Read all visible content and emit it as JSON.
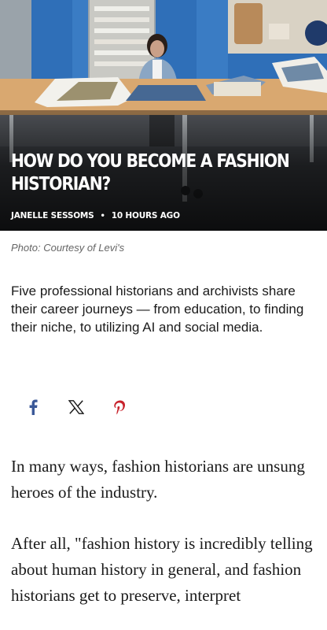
{
  "article": {
    "title": "HOW DO YOU BECOME A FASHION HISTORIAN?",
    "author": "JANELLE SESSOMS",
    "separator": "•",
    "time_ago": "10 HOURS AGO",
    "photo_caption": "Photo: Courtesy of Levi's",
    "dek": "Five professional historians and archivists share their career journeys — from education, to finding their niche, to utilizing AI and social media.",
    "body": [
      "In many ways, fashion historians are unsung heroes of the industry.",
      "After all, \"fashion history is incredibly telling about human history in general, and fashion historians get to preserve, interpret"
    ]
  },
  "share": {
    "buttons": [
      {
        "icon": "facebook-icon",
        "color": "#3b5998"
      },
      {
        "icon": "x-icon",
        "color": "#1a1a1a"
      },
      {
        "icon": "pinterest-icon",
        "color": "#c8232c"
      }
    ]
  },
  "colors": {
    "text": "#1a1a1a",
    "caption": "#666666",
    "hero_overlay_text": "#ffffff"
  }
}
